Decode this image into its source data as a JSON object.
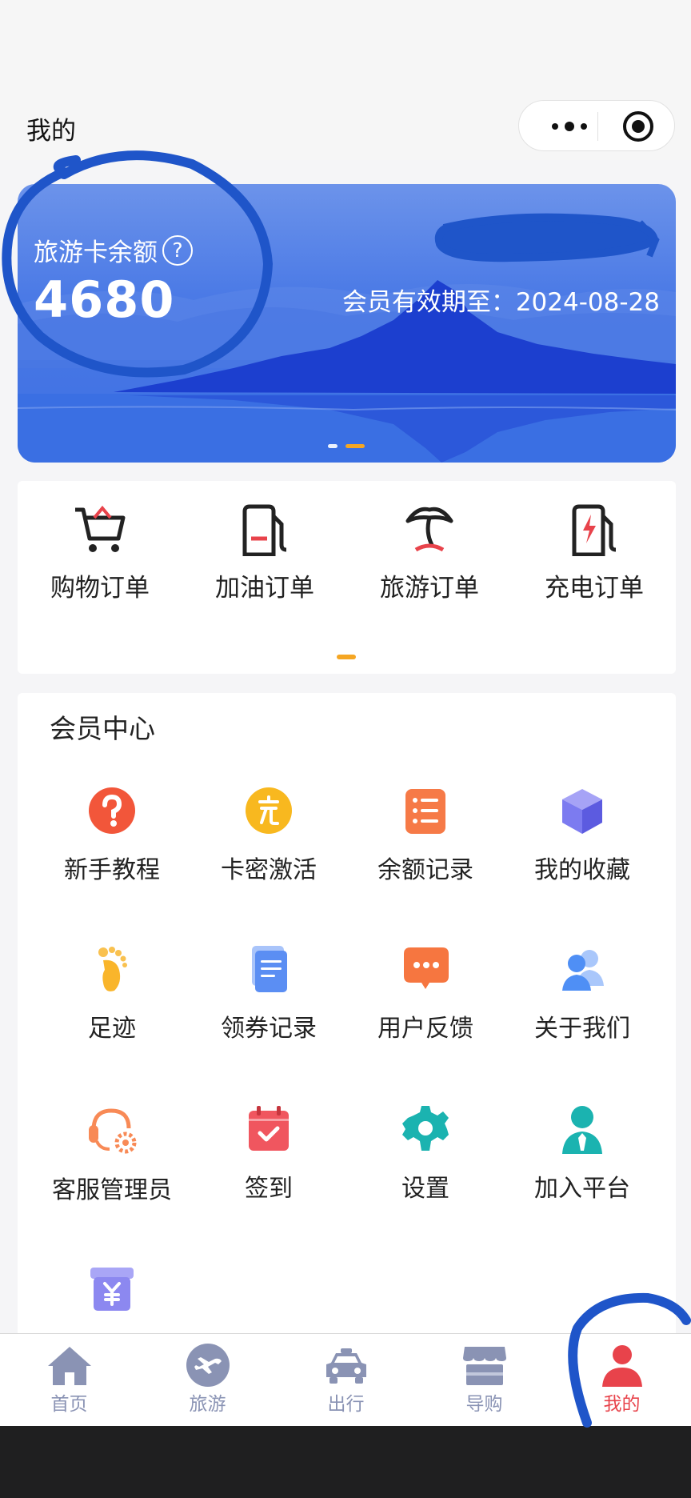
{
  "header": {
    "title": "我的"
  },
  "banner": {
    "balance_label": "旅游卡余额",
    "help_symbol": "?",
    "balance_value": "4680",
    "expiry_text": "会员有效期至：2024-08-28",
    "active_indicator": 2,
    "indicator_count": 2
  },
  "orders": [
    {
      "label": "购物订单",
      "icon": "shopping-cart-icon"
    },
    {
      "label": "加油订单",
      "icon": "fuel-pump-icon"
    },
    {
      "label": "旅游订单",
      "icon": "palm-island-icon"
    },
    {
      "label": "充电订单",
      "icon": "charging-station-icon"
    }
  ],
  "member": {
    "title": "会员中心",
    "items": [
      {
        "label": "新手教程",
        "icon": "question-icon",
        "color": "#f2563a"
      },
      {
        "label": "卡密激活",
        "icon": "recharge-icon",
        "color": "#f8b81f"
      },
      {
        "label": "余额记录",
        "icon": "list-icon",
        "color": "#f67a47"
      },
      {
        "label": "我的收藏",
        "icon": "cube-icon",
        "color": "#7c7bf0"
      },
      {
        "label": "足迹",
        "icon": "footprint-icon",
        "color": "#f9b52b"
      },
      {
        "label": "领券记录",
        "icon": "document-icon",
        "color": "#5b8ef3"
      },
      {
        "label": "用户反馈",
        "icon": "chat-bubble-icon",
        "color": "#f67640"
      },
      {
        "label": "关于我们",
        "icon": "users-icon",
        "color": "#4f8ff5"
      },
      {
        "label": "客服管理员",
        "icon": "headset-gear-icon",
        "color": "#f88a56"
      },
      {
        "label": "签到",
        "icon": "calendar-check-icon",
        "color": "#f0565f"
      },
      {
        "label": "设置",
        "icon": "gear-icon",
        "color": "#1bb3b0"
      },
      {
        "label": "加入平台",
        "icon": "person-tie-icon",
        "color": "#1bb3b0"
      },
      {
        "label": "",
        "icon": "yen-box-icon",
        "color": "#8c88f0"
      }
    ]
  },
  "tabbar": {
    "items": [
      {
        "label": "首页",
        "icon": "home-icon",
        "active": false
      },
      {
        "label": "旅游",
        "icon": "airplane-icon",
        "active": false
      },
      {
        "label": "出行",
        "icon": "car-icon",
        "active": false
      },
      {
        "label": "导购",
        "icon": "store-icon",
        "active": false
      },
      {
        "label": "我的",
        "icon": "profile-icon",
        "active": true
      }
    ],
    "inactive_color": "#8a93b4",
    "active_color": "#e8434b"
  }
}
